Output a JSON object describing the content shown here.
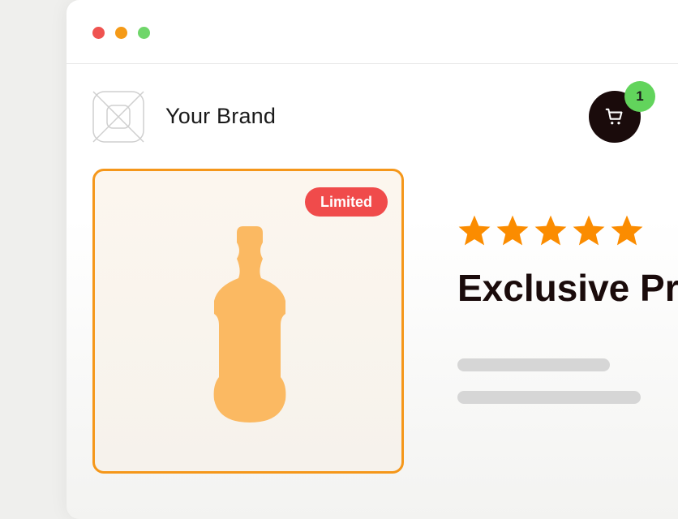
{
  "window": {
    "controls": [
      "close",
      "minimize",
      "maximize"
    ]
  },
  "header": {
    "brand_name": "Your Brand",
    "logo_icon": "image-placeholder-icon",
    "cart_icon": "shopping-cart-icon",
    "cart_count": "1"
  },
  "product": {
    "badge_label": "Limited",
    "image_icon": "bottle-icon",
    "rating": 5,
    "rating_max": 5,
    "title": "Exclusive Pro"
  },
  "colors": {
    "accent": "#f5971a",
    "badge_red": "#f04b4b",
    "cart_green": "#62d45c",
    "cart_dark": "#1a0b0b",
    "star": "#fb8c00",
    "bottle": "#fbb962"
  }
}
